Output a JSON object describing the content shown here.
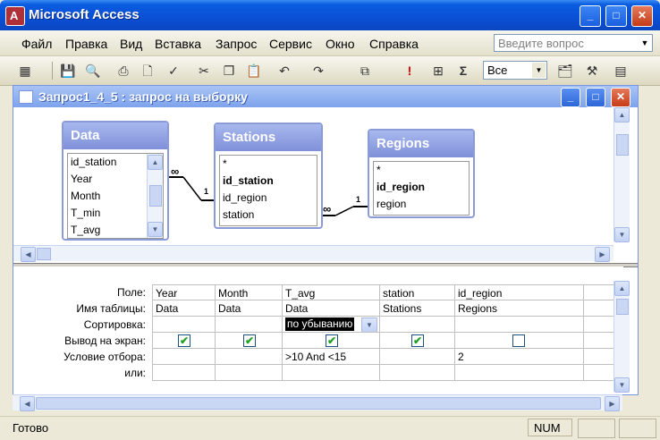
{
  "app": {
    "title": "Microsoft Access",
    "icon": "key-icon"
  },
  "menu": [
    "Файл",
    "Правка",
    "Вид",
    "Вставка",
    "Запрос",
    "Сервис",
    "Окно",
    "Справка"
  ],
  "help_placeholder": "Введите вопрос",
  "toolbar": {
    "view_select": "Все"
  },
  "window": {
    "title": "Запрос1_4_5 : запрос на выборку"
  },
  "tables": [
    {
      "name": "Data",
      "fields": [
        "id_station",
        "Year",
        "Month",
        "T_min",
        "T_avg"
      ]
    },
    {
      "name": "Stations",
      "fields": [
        "*",
        "id_station",
        "id_region",
        "station"
      ]
    },
    {
      "name": "Regions",
      "fields": [
        "*",
        "id_region",
        "region"
      ]
    }
  ],
  "joins": [
    {
      "one": "1",
      "many": "∞"
    },
    {
      "one": "1",
      "many": "∞"
    }
  ],
  "grid": {
    "row_labels": [
      "Поле:",
      "Имя таблицы:",
      "Сортировка:",
      "Вывод на экран:",
      "Условие отбора:",
      "или:"
    ],
    "columns": [
      {
        "field": "Year",
        "table": "Data",
        "sort": "",
        "show": true,
        "criteria": ""
      },
      {
        "field": "Month",
        "table": "Data",
        "sort": "",
        "show": true,
        "criteria": ""
      },
      {
        "field": "T_avg",
        "table": "Data",
        "sort": "по убыванию",
        "show": true,
        "criteria": ">10 And <15"
      },
      {
        "field": "station",
        "table": "Stations",
        "sort": "",
        "show": true,
        "criteria": ""
      },
      {
        "field": "id_region",
        "table": "Regions",
        "sort": "",
        "show": false,
        "criteria": "2"
      }
    ]
  },
  "status": {
    "text": "Готово",
    "num": "NUM"
  }
}
